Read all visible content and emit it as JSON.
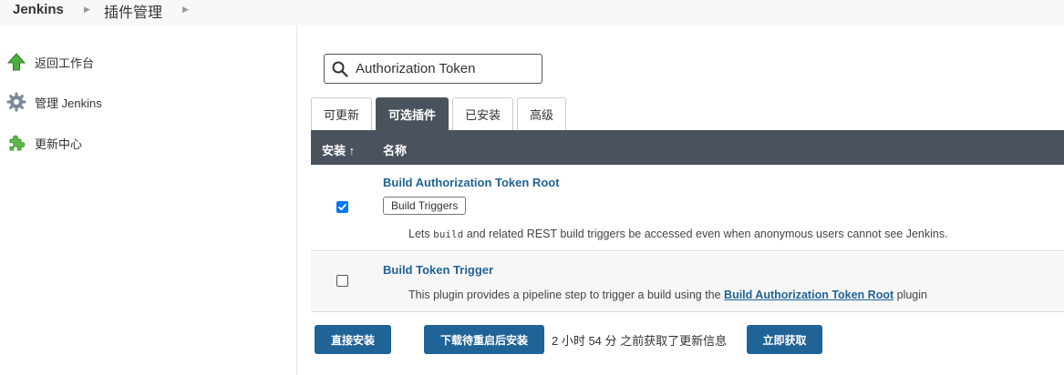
{
  "breadcrumb": {
    "home": "Jenkins",
    "page": "插件管理"
  },
  "sidebar": {
    "items": [
      {
        "label": "返回工作台",
        "icon": "up-arrow-icon"
      },
      {
        "label": "管理 Jenkins",
        "icon": "gear-icon"
      },
      {
        "label": "更新中心",
        "icon": "puzzle-icon"
      }
    ]
  },
  "search": {
    "value": "Authorization Token",
    "placeholder": ""
  },
  "tabs": [
    {
      "label": "可更新",
      "active": false
    },
    {
      "label": "可选插件",
      "active": true
    },
    {
      "label": "已安装",
      "active": false
    },
    {
      "label": "高级",
      "active": false
    }
  ],
  "table": {
    "headers": {
      "install": "安装 ↑",
      "name": "名称"
    },
    "rows": [
      {
        "name": "Build Authorization Token Root",
        "tag": "Build Triggers",
        "checked": true,
        "desc_pre": "Lets ",
        "desc_code": "build",
        "desc_post": " and related REST build triggers be accessed even when anonymous users cannot see Jenkins."
      },
      {
        "name": "Build Token Trigger",
        "checked": false,
        "desc_pre": "This plugin provides a pipeline step to trigger a build using the ",
        "desc_link": "Build Authorization Token Root",
        "desc_post": " plugin"
      }
    ]
  },
  "actions": {
    "install_now": "直接安装",
    "install_after_restart": "下载待重启后安装",
    "update_info": "2 小时 54 分 之前获取了更新信息",
    "check_now": "立即获取"
  },
  "colors": {
    "header_bg": "#4a525d",
    "primary": "#1f6397",
    "checkbox": "#0075ff"
  }
}
